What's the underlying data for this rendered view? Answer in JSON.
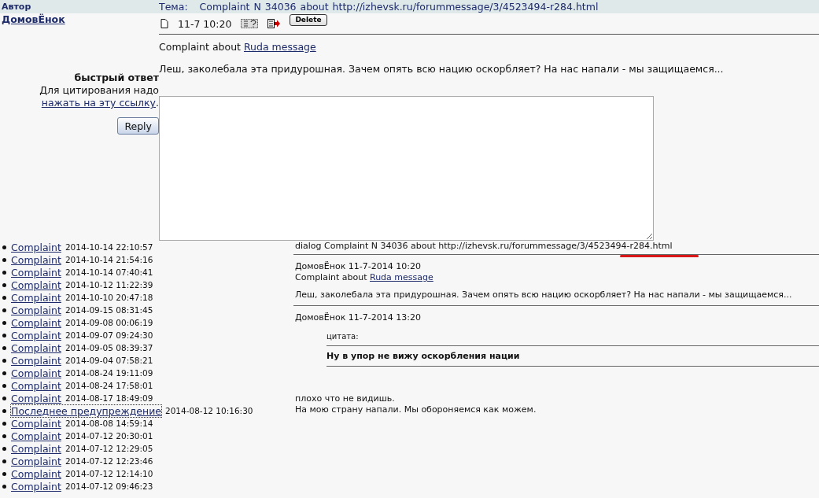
{
  "header": {
    "author_label": "Автор",
    "topic_label": "Тема:",
    "topic": "Complaint N 34036 about http://izhevsk.ru/forummessage/3/4523494-r284.html"
  },
  "post": {
    "author": "ДомовЁнок",
    "time": "11-7 10:20",
    "delete_label": "Delete",
    "complaint_prefix": "Complaint about",
    "complaint_link": "Ruda message",
    "text": "Леш, заколебала эта придурошная. Зачем опять всю нацию оскорбляет? На нас напали - мы защищаемся..."
  },
  "quick_reply": {
    "title": "быстрый ответ",
    "hint": "Для цитирования надо",
    "link": "нажать на эту ссылку",
    "after_link": ".",
    "button": "Reply"
  },
  "complaints": [
    {
      "link": "Complaint",
      "time": "2014-10-14 22:10:57",
      "focused": false
    },
    {
      "link": "Complaint",
      "time": "2014-10-14 21:54:16",
      "focused": false
    },
    {
      "link": "Complaint",
      "time": "2014-10-14 07:40:41",
      "focused": false
    },
    {
      "link": "Complaint",
      "time": "2014-10-12 11:22:39",
      "focused": false
    },
    {
      "link": "Complaint",
      "time": "2014-10-10 20:47:18",
      "focused": false
    },
    {
      "link": "Complaint",
      "time": "2014-09-15 08:31:45",
      "focused": false
    },
    {
      "link": "Complaint",
      "time": "2014-09-08 00:06:19",
      "focused": false
    },
    {
      "link": "Complaint",
      "time": "2014-09-07 09:24:30",
      "focused": false
    },
    {
      "link": "Complaint",
      "time": "2014-09-05 08:39:37",
      "focused": false
    },
    {
      "link": "Complaint",
      "time": "2014-09-04 07:58:21",
      "focused": false
    },
    {
      "link": "Complaint",
      "time": "2014-08-24 19:11:09",
      "focused": false
    },
    {
      "link": "Complaint",
      "time": "2014-08-24 17:58:01",
      "focused": false
    },
    {
      "link": "Complaint",
      "time": "2014-08-17 18:49:09",
      "focused": false
    },
    {
      "link": "Последнее предупреждение",
      "time": "2014-08-12 10:16:30",
      "focused": true
    },
    {
      "link": "Complaint",
      "time": "2014-08-08 14:59:14",
      "focused": false
    },
    {
      "link": "Complaint",
      "time": "2014-07-12 20:30:01",
      "focused": false
    },
    {
      "link": "Complaint",
      "time": "2014-07-12 12:29:05",
      "focused": false
    },
    {
      "link": "Complaint",
      "time": "2014-07-12 12:23:46",
      "focused": false
    },
    {
      "link": "Complaint",
      "time": "2014-07-12 12:14:10",
      "focused": false
    },
    {
      "link": "Complaint",
      "time": "2014-07-12 09:46:23",
      "focused": false
    }
  ],
  "dialog": {
    "title": "dialog Complaint N 34036 about http://izhevsk.ru/forummessage/3/4523494-r284.html",
    "messages": [
      {
        "kind": "message",
        "header": "ДомовЁнок 11-7-2014 10:20",
        "complaint_prefix": "Complaint about",
        "complaint_link": "Ruda message",
        "text": "Леш, заколебала эта придурошная. Зачем опять всю нацию оскорбляет? На нас напали - мы защищаемся..."
      },
      {
        "kind": "reply",
        "header": "ДомовЁнок 11-7-2014 13:20",
        "quote_label": "цитата:",
        "quote": "Ну в упор не вижу оскорбления нации",
        "lines": [
          "плохо что не видишь.",
          "На мою страну напали. Мы обороняемся как можем."
        ]
      }
    ]
  }
}
